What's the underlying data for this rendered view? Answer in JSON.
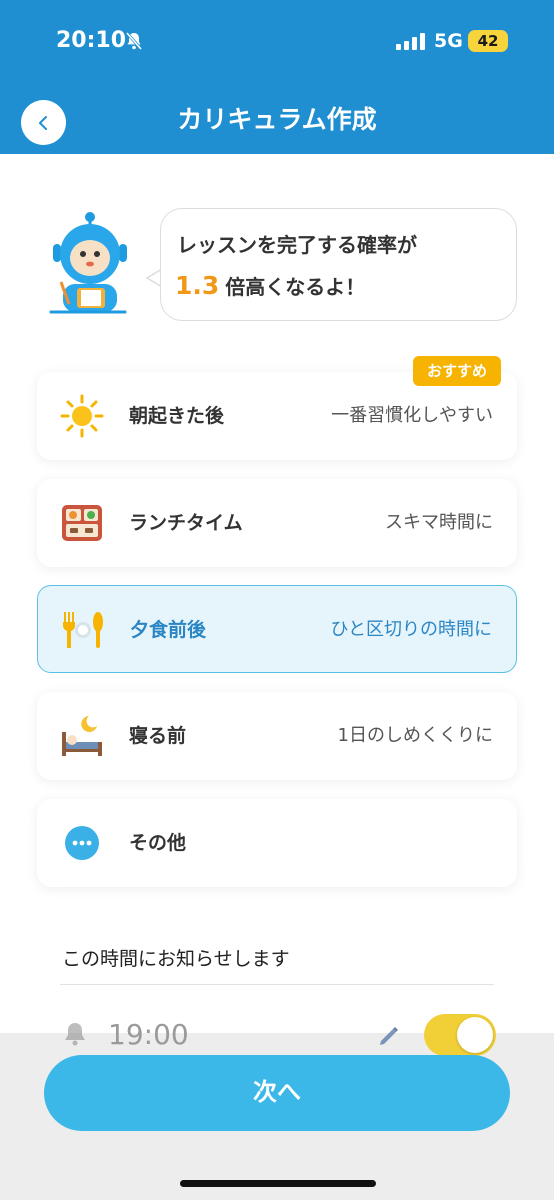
{
  "status_bar": {
    "time": "20:10",
    "network": "5G",
    "battery": "42"
  },
  "nav": {
    "title": "カリキュラム作成"
  },
  "speech_bubble": {
    "line1": "レッスンを完了する確率が",
    "multiplier": "1.3",
    "line2_suffix": "倍高くなるよ！"
  },
  "options": [
    {
      "label": "朝起きた後",
      "description": "一番習慣化しやすい",
      "badge": "おすすめ",
      "icon": "sun-icon"
    },
    {
      "label": "ランチタイム",
      "description": "スキマ時間に",
      "icon": "lunchbox-icon"
    },
    {
      "label": "夕食前後",
      "description": "ひと区切りの時間に",
      "icon": "dinner-utensils-icon",
      "selected": true
    },
    {
      "label": "寝る前",
      "description": "1日のしめくくりに",
      "icon": "bed-moon-icon"
    },
    {
      "label": "その他",
      "description": "",
      "icon": "more-icon"
    }
  ],
  "notification": {
    "title": "この時間にお知らせします",
    "time": "19:00",
    "enabled": true
  },
  "footer": {
    "next_label": "次へ"
  },
  "colors": {
    "header": "#1f8fd2",
    "accent_orange": "#f29818",
    "selected_border": "#5cc0e4",
    "primary_button": "#3bb8e8"
  }
}
